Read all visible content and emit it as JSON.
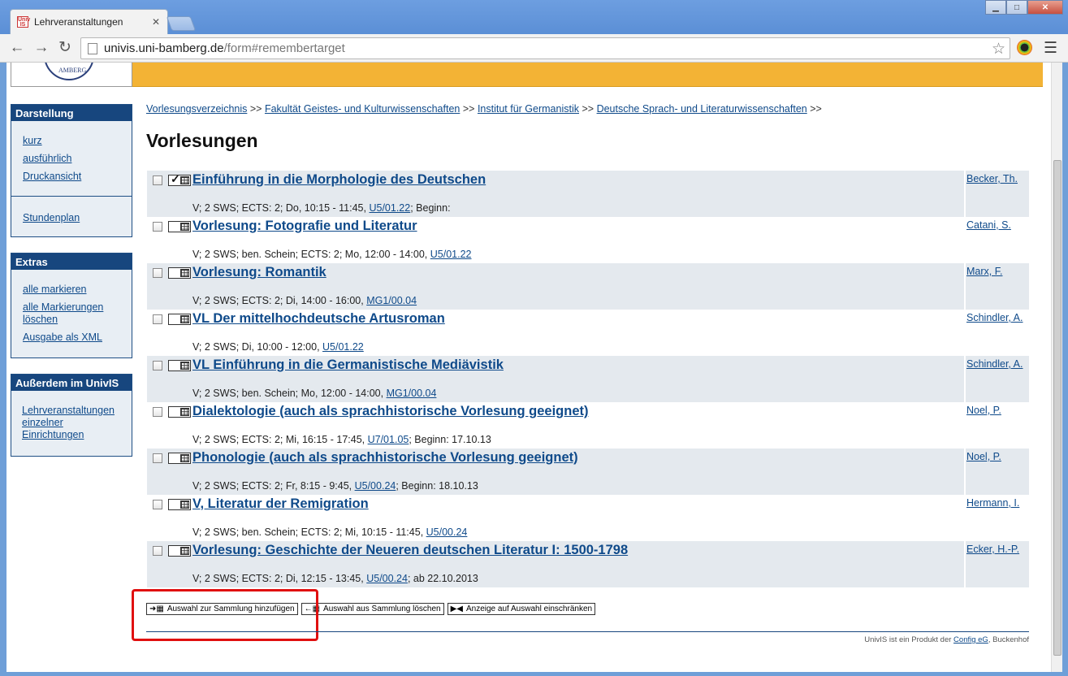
{
  "browser": {
    "tab_title": "Lehrveranstaltungen",
    "tab_icon_text": "Univ IS",
    "url_host": "univis.uni-bamberg.de",
    "url_rest": "/form#remembertarget"
  },
  "sidebar": {
    "darstellung": {
      "title": "Darstellung",
      "links": [
        "kurz",
        "ausführlich",
        "Druckansicht"
      ],
      "extra_link": "Stundenplan"
    },
    "extras": {
      "title": "Extras",
      "links": [
        "alle markieren",
        "alle Markierungen löschen",
        "Ausgabe als XML"
      ]
    },
    "ausserdem": {
      "title": "Außerdem im UnivIS",
      "link": "Lehrveranstaltungen einzelner Einrichtungen"
    }
  },
  "breadcrumb": {
    "items": [
      "Vorlesungsverzeichnis",
      "Fakultät Geistes- und Kulturwissenschaften",
      "Institut für Germanistik",
      "Deutsche Sprach- und Literaturwissenschaften"
    ],
    "separator": ">>"
  },
  "page_title": "Vorlesungen",
  "courses": [
    {
      "title": "Einführung in die Morphologie des Deutschen",
      "lecturer": "Becker, Th.",
      "details_pre": "V; 2 SWS; ECTS: 2; Do, 10:15 - 11:45, ",
      "room": "U5/01.22",
      "details_post": "; Beginn:",
      "checked_calendar": true
    },
    {
      "title": "Vorlesung: Fotografie und Literatur",
      "lecturer": "Catani, S.",
      "details_pre": "V; 2 SWS; ben. Schein; ECTS: 2; Mo, 12:00 - 14:00, ",
      "room": "U5/01.22",
      "details_post": ""
    },
    {
      "title": "Vorlesung: Romantik",
      "lecturer": "Marx, F.",
      "details_pre": "V; 2 SWS; ECTS: 2; Di, 14:00 - 16:00, ",
      "room": "MG1/00.04",
      "details_post": ""
    },
    {
      "title": "VL Der mittelhochdeutsche Artusroman",
      "lecturer": "Schindler, A.",
      "details_pre": "V; 2 SWS; Di, 10:00 - 12:00, ",
      "room": "U5/01.22",
      "details_post": ""
    },
    {
      "title": "VL Einführung in die Germanistische Mediävistik",
      "lecturer": "Schindler, A.",
      "details_pre": "V; 2 SWS; ben. Schein; Mo, 12:00 - 14:00, ",
      "room": "MG1/00.04",
      "details_post": ""
    },
    {
      "title": "Dialektologie (auch als sprachhistorische Vorlesung geeignet)",
      "lecturer": "Noel, P.",
      "details_pre": "V; 2 SWS; ECTS: 2; Mi, 16:15 - 17:45, ",
      "room": "U7/01.05",
      "details_post": "; Beginn: 17.10.13"
    },
    {
      "title": "Phonologie (auch als sprachhistorische Vorlesung geeignet)",
      "lecturer": "Noel, P.",
      "details_pre": "V; 2 SWS; ECTS: 2; Fr, 8:15 - 9:45, ",
      "room": "U5/00.24",
      "details_post": "; Beginn: 18.10.13"
    },
    {
      "title": "V, Literatur der Remigration",
      "lecturer": "Hermann, I.",
      "details_pre": "V; 2 SWS; ben. Schein; ECTS: 2; Mi, 10:15 - 11:45, ",
      "room": "U5/00.24",
      "details_post": ""
    },
    {
      "title": "Vorlesung: Geschichte der Neueren deutschen Literatur I: 1500-1798",
      "lecturer": "Ecker, H.-P.",
      "details_pre": "V; 2 SWS; ECTS: 2; Di, 12:15 - 13:45, ",
      "room": "U5/00.24",
      "details_post": "; ab 22.10.2013"
    }
  ],
  "actions": {
    "add": "Auswahl zur Sammlung hinzufügen",
    "remove": "Auswahl aus Sammlung löschen",
    "restrict": "Anzeige auf Auswahl einschränken"
  },
  "footer": {
    "pre": "UnivIS ist ein Produkt der ",
    "link": "Config eG",
    "post": ", Buckenhof"
  },
  "colors": {
    "banner": "#f3b335",
    "sidebar_head": "#17467e",
    "link": "#0f4a8a",
    "row_shade": "#e4e9ee",
    "highlight": "#e01010"
  }
}
